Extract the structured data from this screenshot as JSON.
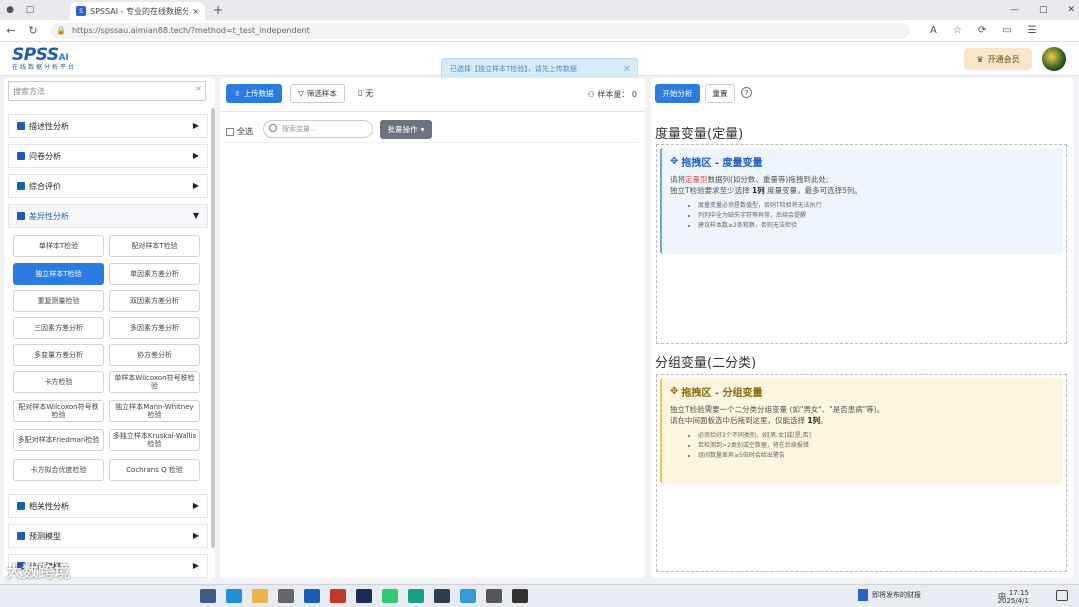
{
  "browser": {
    "tab_title": "SPSSAI - 专业的在线数据分析平台",
    "tab_favicon": "S",
    "url": "https://spssau.aimian88.tech/?method=t_test_independent"
  },
  "header": {
    "logo_text": "SPSS",
    "logo_ai": "AI",
    "logo_sub": "在线数据分析平台",
    "member_label": "开通会员"
  },
  "toast": {
    "text": "已选择【独立样本T检验】，请先上传数据"
  },
  "sidebar": {
    "search_placeholder": "搜索方法",
    "categories": [
      {
        "label": "描述性分析"
      },
      {
        "label": "问卷分析"
      },
      {
        "label": "综合评价"
      },
      {
        "label": "差异性分析"
      },
      {
        "label": "相关性分析"
      },
      {
        "label": "预测模型"
      },
      {
        "label": "统计建模"
      }
    ],
    "methods": [
      "单样本T检验",
      "配对样本T检验",
      "独立样本T检验",
      "单因素方差分析",
      "重复测量检验",
      "双因素方差分析",
      "三因素方差分析",
      "多因素方差分析",
      "多变量方差分析",
      "协方差分析",
      "卡方检验",
      "单样本Wilcoxon符号秩检验",
      "配对样本Wilcoxon符号秩检验",
      "独立样本Mann-Whitney检验",
      "多配对样本Friedman检验",
      "多独立样本Kruskal-Wallis检验",
      "卡方拟合优度检验",
      "Cochrans Q 检验"
    ]
  },
  "middle": {
    "upload_label": "上传数据",
    "filter_label": "筛选样本",
    "file_label": "无",
    "samples_label": "样本量：",
    "samples_value": "0",
    "select_all_label": "全选",
    "var_search_placeholder": "搜索变量...",
    "batch_label": "批量操作"
  },
  "right": {
    "start_label": "开始分析",
    "reset_label": "重置",
    "help_icon": "?",
    "metric_title": "度量变量(定量)",
    "metric_zone": {
      "heading": "拖拽区 - 度量变量",
      "line1_a": "请将",
      "line1_red": "定量型",
      "line1_b": "数据列(如分数、重量等)拖拽到此处;",
      "line2_a": "独立T检验要求至少选择 ",
      "line2_b": "1列",
      "line2_c": " 度量变量，最多可选择5列。",
      "bullets": [
        "度量变量必须是数值型，否则T检验将无法执行",
        "列列中全为缺失字符等异常，后续会提醒",
        "建议样本数≥2条观察，否则无法检验"
      ]
    },
    "group_title": "分组变量(二分类)",
    "group_zone": {
      "heading": "拖拽区 - 分组变量",
      "line1": "独立T检验需要一个二分类分组变量 (如\"男女\"、\"是否患病\"等)。",
      "line2_a": "请在中间面板选中后拖到这里，仅能选择 ",
      "line2_b": "1列",
      "line2_c": "。",
      "bullets": [
        "必须恰好2个不同类别，如[男,女]或[是,否]",
        "若检测到>2类别或空数据，将在后续报错",
        "组间数量差异≥5倍时会给出警告"
      ]
    }
  },
  "taskbar": {
    "watermark": "大数跨境",
    "time": "17:15",
    "date": "2025/4/1",
    "lang": "中",
    "news": "即将发布的财报"
  },
  "colors": {
    "primary": "#2a7be4",
    "brand": "#1e5bb8",
    "toast_bg": "#d6ebf8",
    "zone_blue": "#eef5fd",
    "zone_yellow": "#fdf5de"
  }
}
